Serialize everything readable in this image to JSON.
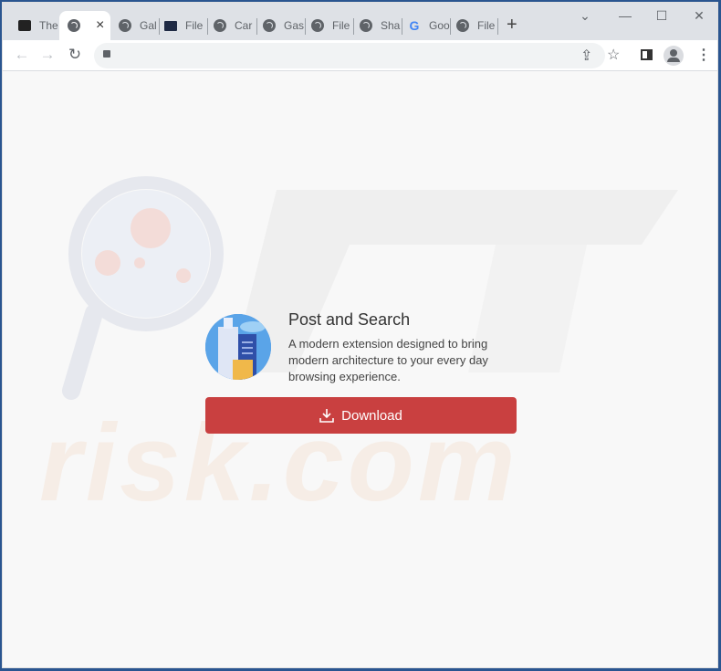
{
  "browser": {
    "tabs": [
      {
        "label": "The",
        "icon": "app-favicon-icon"
      },
      {
        "label": "",
        "icon": "globe-icon",
        "active": true
      },
      {
        "label": "Gal",
        "icon": "globe-icon"
      },
      {
        "label": "File",
        "icon": "folder-arrow-icon"
      },
      {
        "label": "Car",
        "icon": "globe-icon"
      },
      {
        "label": "Gas",
        "icon": "globe-icon"
      },
      {
        "label": "File",
        "icon": "globe-icon"
      },
      {
        "label": "Sha",
        "icon": "globe-icon"
      },
      {
        "label": "Goo",
        "icon": "google-icon"
      },
      {
        "label": "File",
        "icon": "globe-icon"
      }
    ],
    "close_tab": "×",
    "new_tab": "+",
    "url": ""
  },
  "page": {
    "title": "Post and Search",
    "description": "A modern extension designed to bring modern architecture to your every day browsing experience.",
    "download_label": "Download",
    "watermark": "risk.com",
    "colors": {
      "button": "#c94040",
      "background": "#f8f8f8"
    }
  }
}
